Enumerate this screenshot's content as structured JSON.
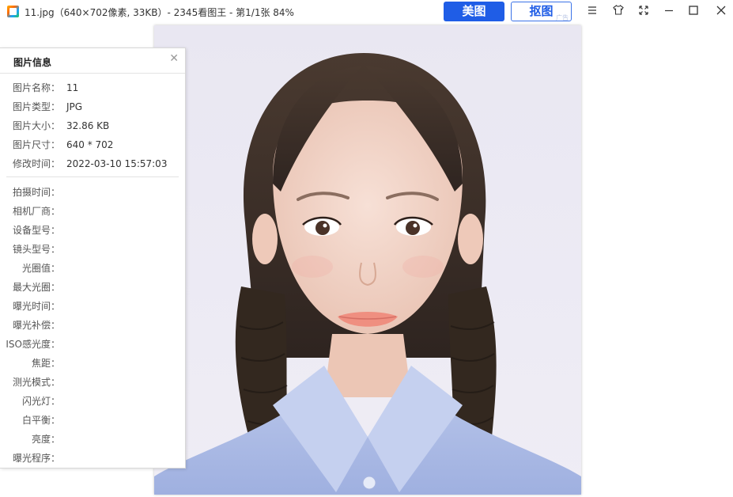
{
  "window": {
    "title": "11.jpg（640×702像素, 33KB）- 2345看图王 - 第1/1张 84%",
    "meitu_button": "美图",
    "koutu_button": "抠图",
    "ad_label": "广告"
  },
  "info_panel": {
    "title": "图片信息",
    "basic": [
      {
        "label": "图片名称：",
        "value": "11"
      },
      {
        "label": "图片类型：",
        "value": "JPG"
      },
      {
        "label": "图片大小：",
        "value": "32.86 KB"
      },
      {
        "label": "图片尺寸：",
        "value": "640 * 702"
      },
      {
        "label": "修改时间：",
        "value": "2022-03-10 15:57:03"
      }
    ],
    "exif": [
      {
        "label": "拍摄时间：",
        "value": ""
      },
      {
        "label": "相机厂商：",
        "value": ""
      },
      {
        "label": "设备型号：",
        "value": ""
      },
      {
        "label": "镜头型号：",
        "value": ""
      },
      {
        "label": "光圈值：",
        "value": ""
      },
      {
        "label": "最大光圈：",
        "value": ""
      },
      {
        "label": "曝光时间：",
        "value": ""
      },
      {
        "label": "曝光补偿：",
        "value": ""
      },
      {
        "label": "ISO感光度：",
        "value": ""
      },
      {
        "label": "焦距：",
        "value": ""
      },
      {
        "label": "测光模式：",
        "value": ""
      },
      {
        "label": "闪光灯：",
        "value": ""
      },
      {
        "label": "白平衡：",
        "value": ""
      },
      {
        "label": "亮度：",
        "value": ""
      },
      {
        "label": "曝光程序：",
        "value": ""
      }
    ]
  }
}
